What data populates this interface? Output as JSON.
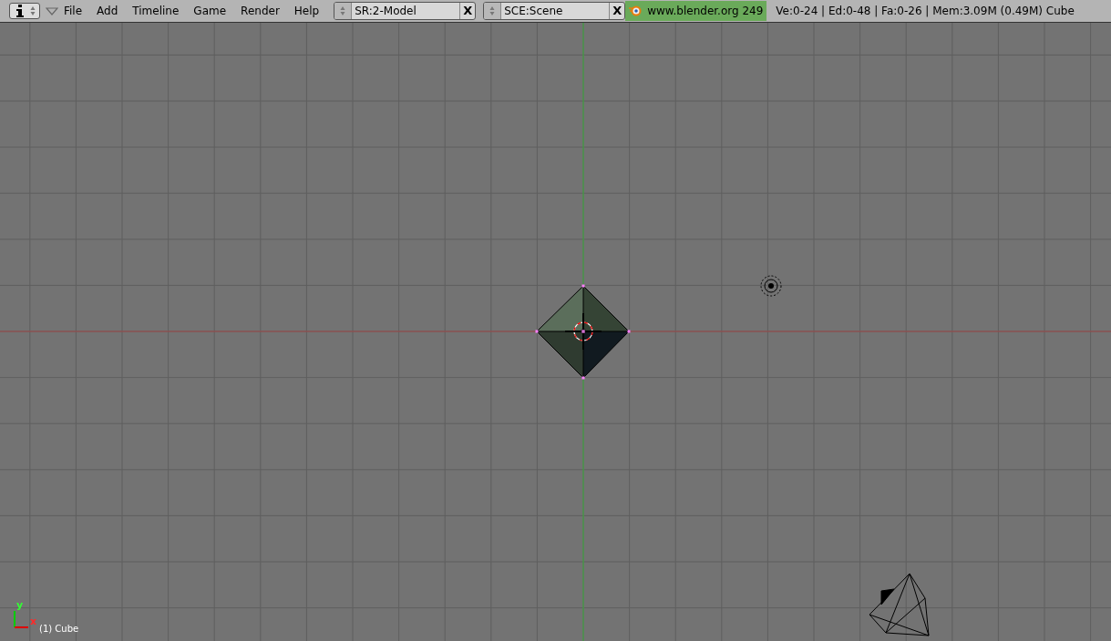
{
  "header": {
    "menus": [
      {
        "label": "File"
      },
      {
        "label": "Add"
      },
      {
        "label": "Timeline"
      },
      {
        "label": "Game"
      },
      {
        "label": "Render"
      },
      {
        "label": "Help"
      }
    ],
    "screen_selector": {
      "value": "SR:2-Model",
      "close_glyph": "X"
    },
    "scene_selector": {
      "value": "SCE:Scene",
      "close_glyph": "X"
    },
    "version_label": "www.blender.org 249",
    "stats": "Ve:0-24 | Ed:0-48 | Fa:0-26 | Mem:3.09M (0.49M) Cube"
  },
  "viewport": {
    "axis_labels": {
      "x": "x",
      "y": "y"
    },
    "object_label": "(1) Cube"
  }
}
